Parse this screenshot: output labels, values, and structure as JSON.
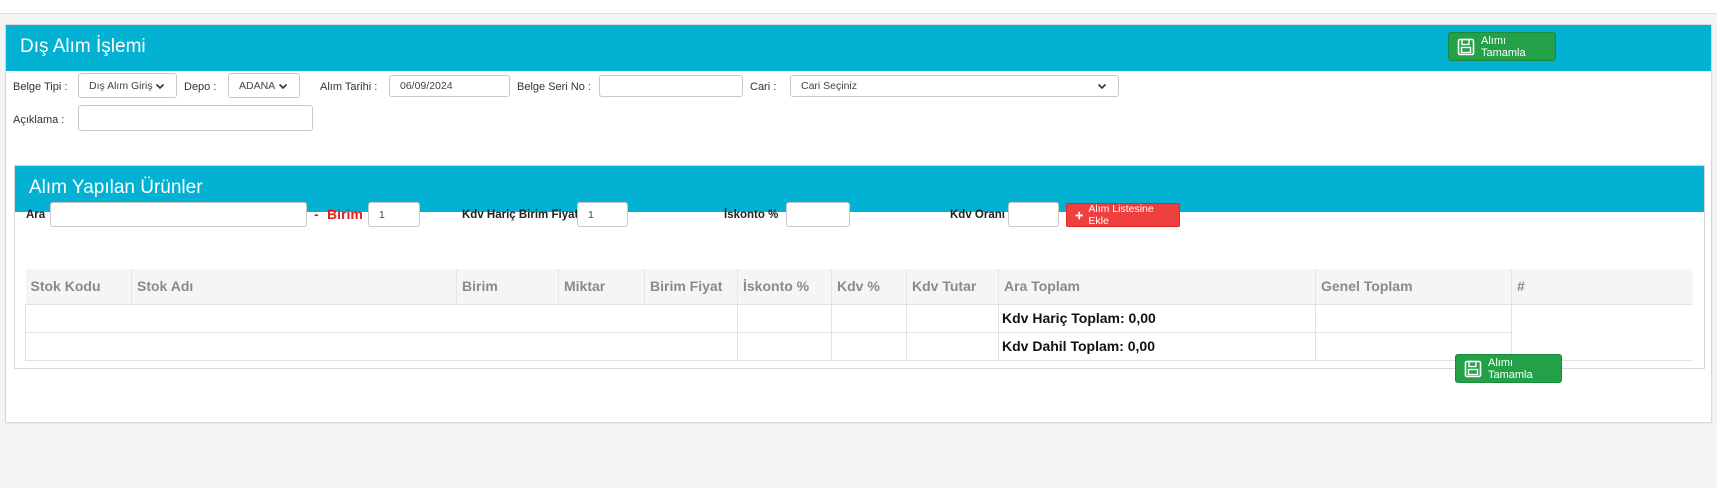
{
  "page": {
    "title": "Dış Alım İşlemi",
    "complete_button": "Alımı Tamamla"
  },
  "form": {
    "belge_tipi_label": "Belge Tipi :",
    "belge_tipi_value": "Dış Alım Giriş",
    "depo_label": "Depo :",
    "depo_value": "ADANA",
    "alim_tarihi_label": "Alım Tarihi :",
    "alim_tarihi_value": "06/09/2024",
    "belge_seri_no_label": "Belge Seri No :",
    "belge_seri_no_value": "",
    "cari_label": "Cari :",
    "cari_value": "Cari Seçiniz",
    "aciklama_label": "Açıklama :",
    "aciklama_value": ""
  },
  "products": {
    "title": "Alım Yapılan Ürünler",
    "ara_label": "Ara",
    "ara_value": "",
    "dash": "-",
    "birim_label": "Birim",
    "birim_value": "1",
    "kdv_haric_birim_fiyat_label": "Kdv Hariç Birim Fiyat",
    "kdv_haric_birim_fiyat_value": "1",
    "iskonto_label": "İskonto %",
    "iskonto_value": "",
    "kdv_orani_label": "Kdv Oranı",
    "kdv_orani_value": "",
    "add_button": "Alım Listesine Ekle"
  },
  "table": {
    "columns": [
      "Stok Kodu",
      "Stok Adı",
      "Birim",
      "Miktar",
      "Birim Fiyat",
      "İskonto %",
      "Kdv %",
      "Kdv Tutar",
      "Ara Toplam",
      "Genel Toplam",
      "#"
    ],
    "kdv_haric_toplam": "Kdv Hariç Toplam: 0,00",
    "kdv_dahil_toplam": "Kdv Dahil Toplam: 0,00"
  },
  "colors": {
    "header_bg": "#03b1d2",
    "green_button": "#23a149",
    "red_button": "#ef3e3e",
    "birim_red": "#e02020"
  },
  "icons": {
    "save": "floppy-disk-icon",
    "chevron": "chevron-down-icon",
    "plus": "plus-icon"
  }
}
